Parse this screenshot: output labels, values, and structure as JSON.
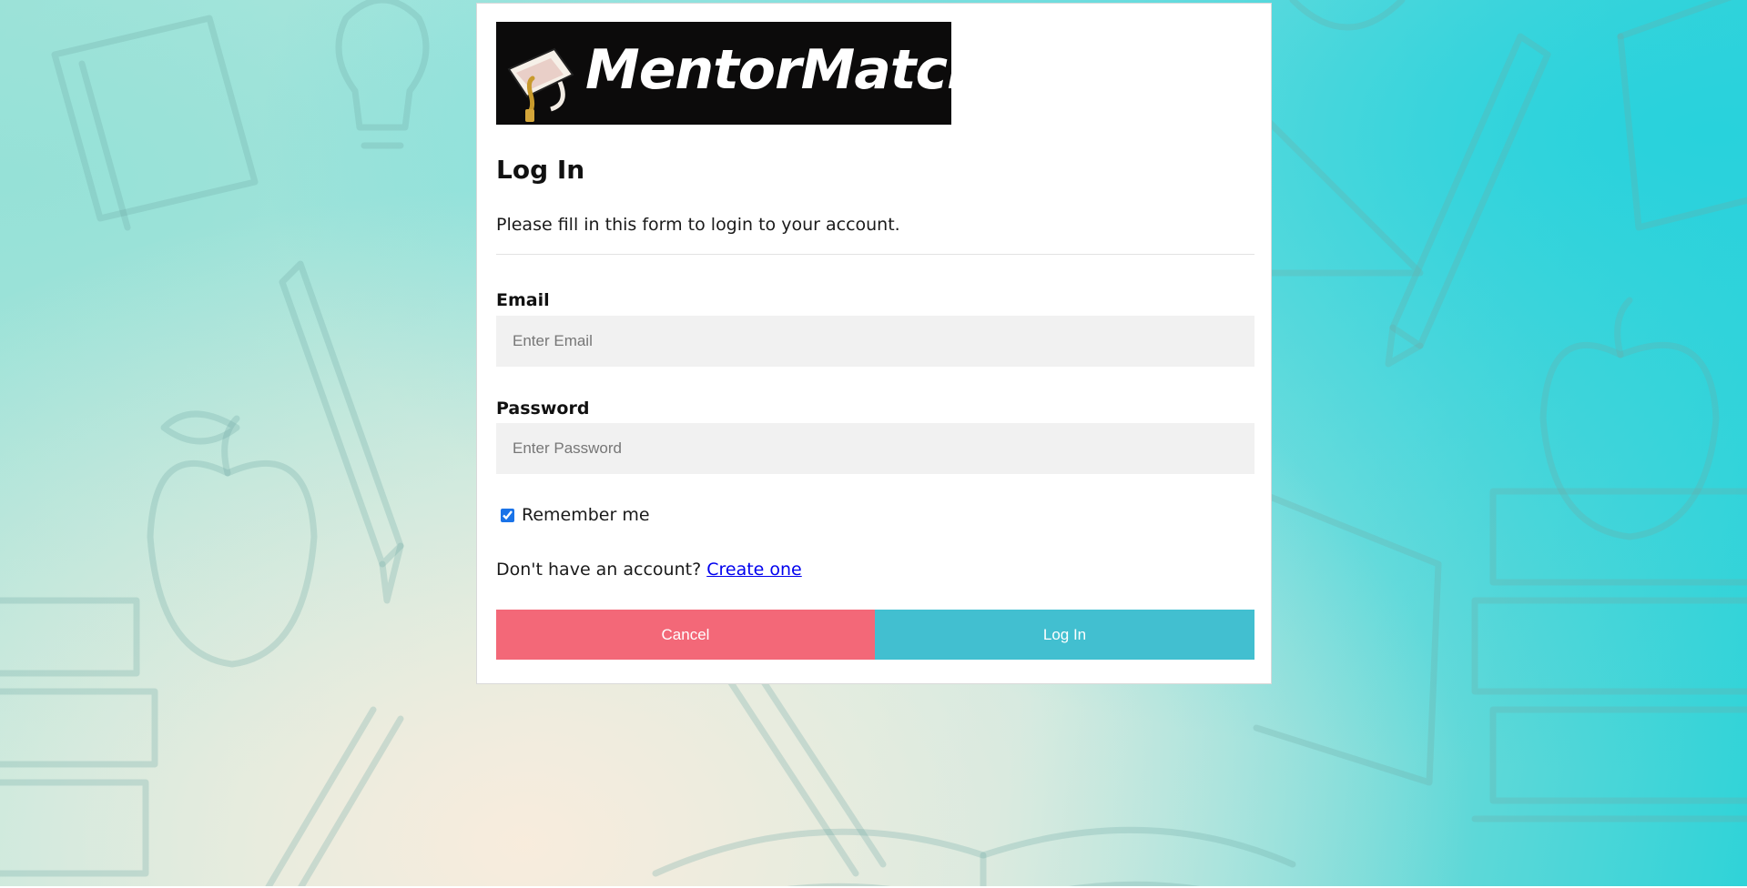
{
  "brand": {
    "name": "MentorMatch",
    "logo_icon": "graduation-cap-icon"
  },
  "form": {
    "title": "Log In",
    "subtitle": "Please fill in this form to login to your account.",
    "email": {
      "label": "Email",
      "placeholder": "Enter Email",
      "value": ""
    },
    "password": {
      "label": "Password",
      "placeholder": "Enter Password",
      "value": ""
    },
    "remember": {
      "label": "Remember me",
      "checked": true
    },
    "signup": {
      "prompt": "Don't have an account?",
      "link": "Create one"
    },
    "buttons": {
      "cancel": "Cancel",
      "login": "Log In"
    }
  },
  "colors": {
    "cancel": "#f36878",
    "login": "#42bfd0",
    "link": "#0000ee",
    "input_bg": "#f1f1f1"
  }
}
